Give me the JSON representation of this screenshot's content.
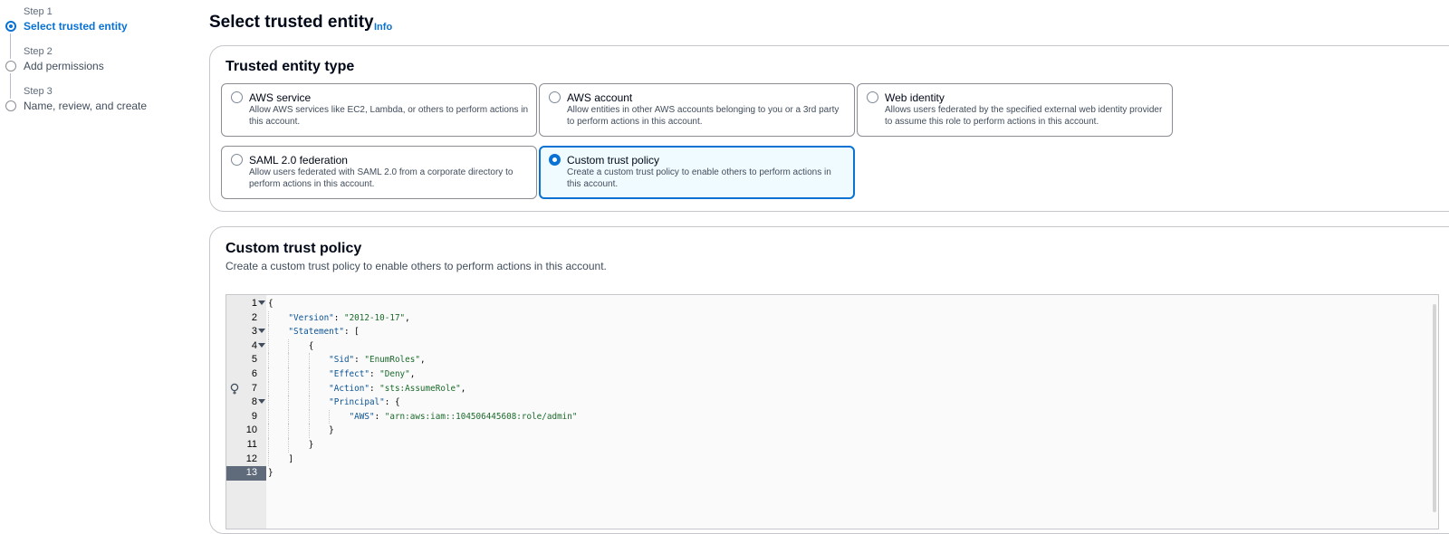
{
  "steps": [
    {
      "num": "Step 1",
      "label": "Select trusted entity",
      "active": true
    },
    {
      "num": "Step 2",
      "label": "Add permissions",
      "active": false
    },
    {
      "num": "Step 3",
      "label": "Name, review, and create",
      "active": false
    }
  ],
  "header": {
    "title": "Select trusted entity",
    "info": "Info"
  },
  "trusted_entity": {
    "title": "Trusted entity type",
    "options": [
      {
        "title": "AWS service",
        "desc": "Allow AWS services like EC2, Lambda, or others to perform actions in this account.",
        "selected": false
      },
      {
        "title": "AWS account",
        "desc": "Allow entities in other AWS accounts belonging to you or a 3rd party to perform actions in this account.",
        "selected": false
      },
      {
        "title": "Web identity",
        "desc": "Allows users federated by the specified external web identity provider to assume this role to perform actions in this account.",
        "selected": false
      },
      {
        "title": "SAML 2.0 federation",
        "desc": "Allow users federated with SAML 2.0 from a corporate directory to perform actions in this account.",
        "selected": false
      },
      {
        "title": "Custom trust policy",
        "desc": "Create a custom trust policy to enable others to perform actions in this account.",
        "selected": true
      }
    ]
  },
  "custom_policy": {
    "title": "Custom trust policy",
    "desc": "Create a custom trust policy to enable others to perform actions in this account.",
    "active_line": 13,
    "lines": [
      "{",
      "    \"Version\": \"2012-10-17\",",
      "    \"Statement\": [",
      "        {",
      "            \"Sid\": \"EnumRoles\",",
      "            \"Effect\": \"Deny\",",
      "            \"Action\": \"sts:AssumeRole\",",
      "            \"Principal\": {",
      "                \"AWS\": \"arn:aws:iam::104506445608:role/admin\"",
      "            }",
      "        }",
      "    ]",
      "}"
    ],
    "fold_lines": [
      1,
      3,
      4,
      8
    ],
    "hint_line": 7
  }
}
